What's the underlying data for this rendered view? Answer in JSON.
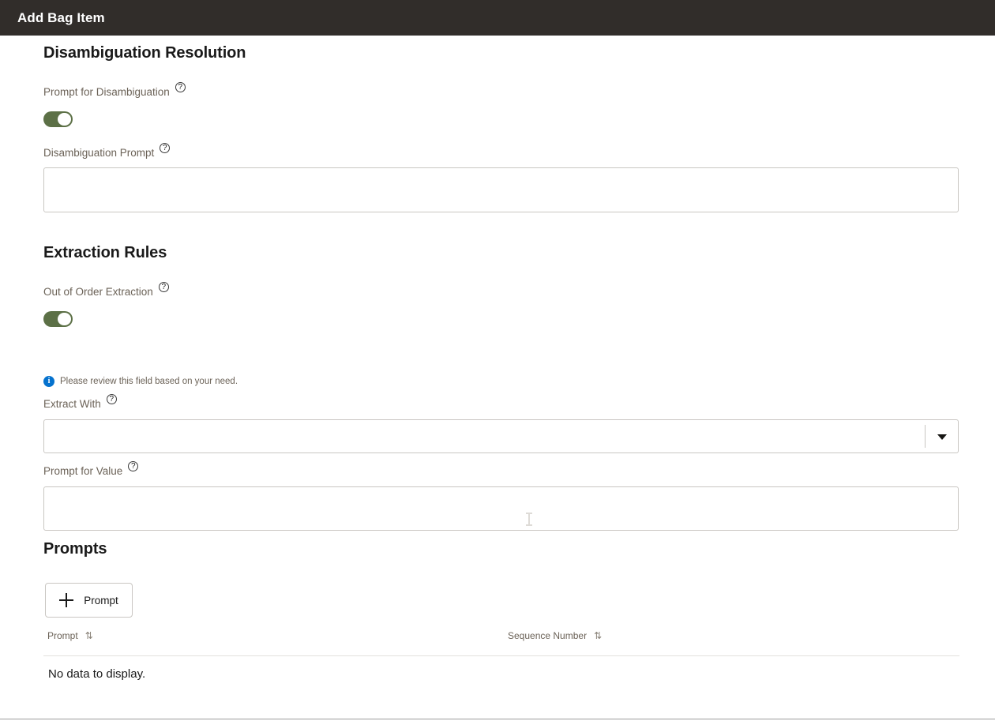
{
  "window": {
    "title": "Add Bag Item",
    "header_bg": "#312d2a"
  },
  "colors": {
    "toggle_on": "#5c7046",
    "info_icon": "#0572ce",
    "border": "#c9c6c2",
    "label_text": "#6b6257"
  },
  "sections": {
    "disambiguation": {
      "heading": "Disambiguation Resolution",
      "prompt_for_disambiguation": {
        "label": "Prompt for Disambiguation",
        "toggle_state": "on",
        "help": "?"
      },
      "disambiguation_prompt": {
        "label": "Disambiguation Prompt",
        "value": "",
        "placeholder": "",
        "help": "?"
      }
    },
    "extraction_rules": {
      "heading": "Extraction Rules",
      "out_of_order_extraction": {
        "label": "Out of Order Extraction",
        "toggle_state": "on",
        "help": "?"
      },
      "info_message": {
        "icon": "i",
        "text": "Please review this field based on your need."
      },
      "extract_with": {
        "label": "Extract With",
        "value": "",
        "placeholder": "",
        "help": "?",
        "arrow": "chevron-down-icon"
      },
      "prompt_for_value": {
        "label": "Prompt for Value",
        "value": "",
        "placeholder": "",
        "help": "?"
      }
    },
    "prompts": {
      "heading": "Prompts",
      "add_button_label": "Prompt",
      "add_button_icon": "plus-icon",
      "table": {
        "columns": [
          {
            "label": "Prompt",
            "sort_icon": "⇅"
          },
          {
            "label": "Sequence Number",
            "sort_icon": "⇅"
          }
        ],
        "empty_message": "No data to display.",
        "rows": []
      }
    }
  }
}
